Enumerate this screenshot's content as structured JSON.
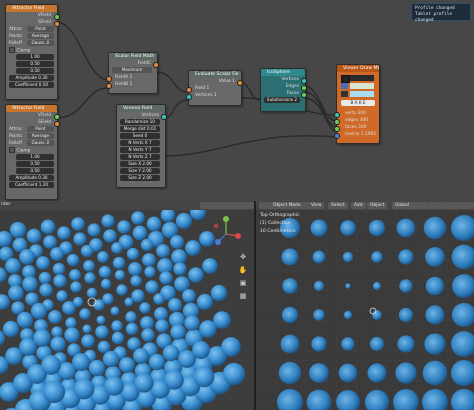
{
  "notice": {
    "line1": "Profile changed",
    "line2": "Tablet profile changed"
  },
  "nodes": {
    "attractor1": {
      "title": "Attractor Field",
      "vfield": "VField",
      "sfield": "SField",
      "attractor_type_label": "Attrac",
      "attractor_type": "Point",
      "points_mode_label": "Points",
      "points_mode": "Average",
      "falloff_label": "Falloff",
      "falloff": "Gauss..Il",
      "clamp": "Clamp",
      "vals": [
        "1.00",
        "0.50",
        "0.50"
      ],
      "amplitude": "Amplitude  0.30",
      "coefficient": "Coefficient  0.50"
    },
    "attractor2": {
      "title": "Attractor Field",
      "vfield": "VField",
      "sfield": "SField",
      "attractor_type_label": "Attrac",
      "attractor_type": "Point",
      "points_mode_label": "Points",
      "points_mode": "Average",
      "falloff_label": "Falloff",
      "falloff": "Gauss..Il",
      "clamp": "Clamp",
      "vals": [
        "1.00",
        "0.50",
        "0.50"
      ],
      "amplitude": "Amplitude  0.30",
      "coefficient": "Coefficient  1.20"
    },
    "scalar_math": {
      "title": "Scalar Field Math",
      "output": "FieldC",
      "mode": "Maximum",
      "field_a": "FieldA  1",
      "field_b": "FieldB  1"
    },
    "voronoi": {
      "title": "Voronoi Field",
      "output": "Vertices",
      "randomize": "Randomize  10",
      "merge_dist": "Merge dist  0.01",
      "seed": "Seed  0",
      "n_verts_x": "N Verts X  7",
      "n_verts_y": "N Verts Y  7",
      "n_verts_z": "N Verts Z  7",
      "size_x": "Size X  2.00",
      "size_y": "Size Y  2.00",
      "size_z": "Size Z  2.00"
    },
    "evaluate": {
      "title": "Evaluate Scalar Fie",
      "value": "Value  1",
      "field": "Field  1",
      "vertices": "Vertices  1"
    },
    "icosphere": {
      "title": "IcoSphere",
      "subdivisions": "Subdivisions  2",
      "outputs": [
        "Vertices",
        "Edges",
        "Faces"
      ]
    },
    "viewer": {
      "title": "Viewer Draw Mk3",
      "bake": "B A K E",
      "inputs": [
        "verts  300",
        "edges  300",
        "faces  300",
        "matrix  1 2905"
      ]
    }
  },
  "left_viewport": {
    "menu": "Object Mode",
    "header_left": "rder",
    "tools": [
      "move-icon",
      "grab-icon",
      "camera-icon",
      "grid-icon"
    ],
    "sphere_color": "#3a8ed0"
  },
  "right_viewport": {
    "mode": "Object Mode",
    "menus": [
      "View",
      "Select",
      "Add",
      "Object"
    ],
    "transform": "Global",
    "info": [
      "Top Orthographic",
      "(1) Collection",
      "10 Centimeters"
    ],
    "sphere_color": "#3a8ed0"
  }
}
